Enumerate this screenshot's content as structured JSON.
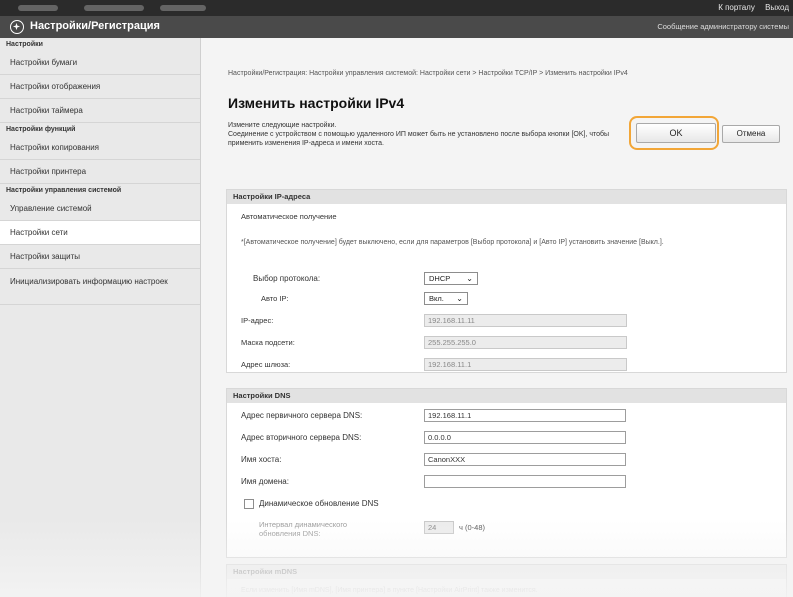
{
  "topbar": {
    "links": [
      "К порталу",
      "Выход"
    ]
  },
  "header": {
    "title": "Настройки/Регистрация",
    "message": "Сообщение администратору системы"
  },
  "sidebar": {
    "sections": [
      {
        "title": "Настройки",
        "items": [
          "Настройки бумаги",
          "Настройки отображения",
          "Настройки таймера"
        ]
      },
      {
        "title": "Настройки функций",
        "items": [
          "Настройки копирования",
          "Настройки принтера"
        ]
      },
      {
        "title": "Настройки управления системой",
        "items": [
          "Управление системой",
          "Настройки сети",
          "Настройки защиты",
          "Инициализировать информацию настроек"
        ]
      }
    ],
    "active": "Настройки сети"
  },
  "main": {
    "breadcrumb": "Настройки/Регистрация: Настройки управления системой: Настройки сети > Настройки TCP/IP > Изменить настройки IPv4",
    "title": "Изменить настройки IPv4",
    "intro_1": "Измените следующие настройки.",
    "intro_2": "Соединение с устройством с помощью удаленного ИП может быть не установлено после выбора кнопки [OK], чтобы применить изменения IP-адреса и имени хоста.",
    "ok_label": "OK",
    "cancel_label": "Отмена"
  },
  "ip_section": {
    "title": "Настройки IP-адреса",
    "auto_label": "Автоматическое получение",
    "note": "*[Автоматическое получение] будет выключено, если для параметров [Выбор протокола] и [Авто IP] установить значение [Выкл.].",
    "protocol_label": "Выбор протокола:",
    "protocol_value": "DHCP",
    "autoip_label": "Авто IP:",
    "autoip_value": "Вкл.",
    "ip_label": "IP-адрес:",
    "ip_value": "192.168.11.11",
    "mask_label": "Маска подсети:",
    "mask_value": "255.255.255.0",
    "gateway_label": "Адрес шлюза:",
    "gateway_value": "192.168.11.1"
  },
  "dns_section": {
    "title": "Настройки DNS",
    "primary_label": "Адрес первичного сервера DNS:",
    "primary_value": "192.168.11.1",
    "secondary_label": "Адрес вторичного сервера DNS:",
    "secondary_value": "0.0.0.0",
    "host_label": "Имя хоста:",
    "host_value": "CanonXXX",
    "domain_label": "Имя домена:",
    "domain_value": "",
    "dyn_label": "Динамическое обновление DNS",
    "interval_label": "Интервал динамического обновления DNS:",
    "interval_value": "24",
    "interval_unit": "ч (0-48)"
  },
  "mdns_section": {
    "title": "Настройки mDNS",
    "note": "Если изменить [Имя mDNS], [Имя принтера] в пункте [Настройки AirPrint] также изменится."
  }
}
